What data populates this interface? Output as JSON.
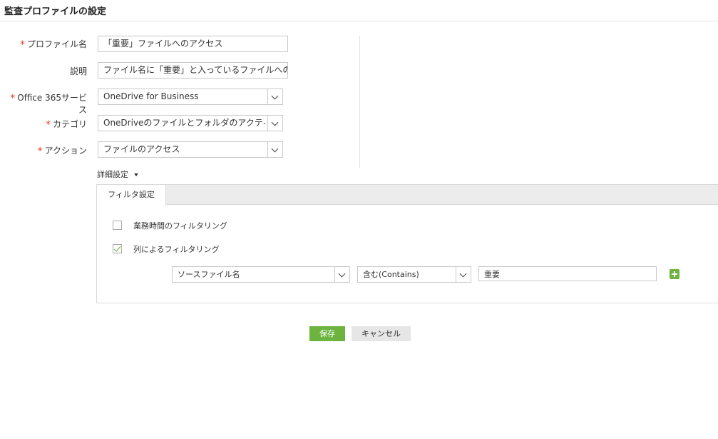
{
  "page": {
    "title": "監査プロファイルの設定"
  },
  "form": {
    "profile_name": {
      "label": "プロファイル名",
      "value": "「重要」ファイルへのアクセス"
    },
    "description": {
      "label": "説明",
      "value": "ファイル名に「重要」と入っているファイルへのアクセス"
    },
    "service": {
      "label": "Office 365サービス",
      "value": "OneDrive for Business"
    },
    "category": {
      "label": "カテゴリ",
      "value": "OneDriveのファイルとフォルダのアクティビティ"
    },
    "action": {
      "label": "アクション",
      "value": "ファイルのアクセス"
    }
  },
  "advanced": {
    "toggle_label": "詳細設定",
    "tab_label": "フィルタ設定",
    "business_hours": {
      "label": "業務時間のフィルタリング",
      "checked": false
    },
    "column_filter": {
      "label": "列によるフィルタリング",
      "checked": true
    },
    "filter_row": {
      "column": "ソースファイル名",
      "operator": "含む(Contains)",
      "value": "重要"
    }
  },
  "buttons": {
    "save": "保存",
    "cancel": "キャンセル"
  },
  "colors": {
    "accent": "#6cb33f",
    "required": "#e8402c"
  },
  "icons": {
    "dropdown": "chevron-down-icon",
    "add": "plus-icon",
    "check": "check-icon"
  }
}
